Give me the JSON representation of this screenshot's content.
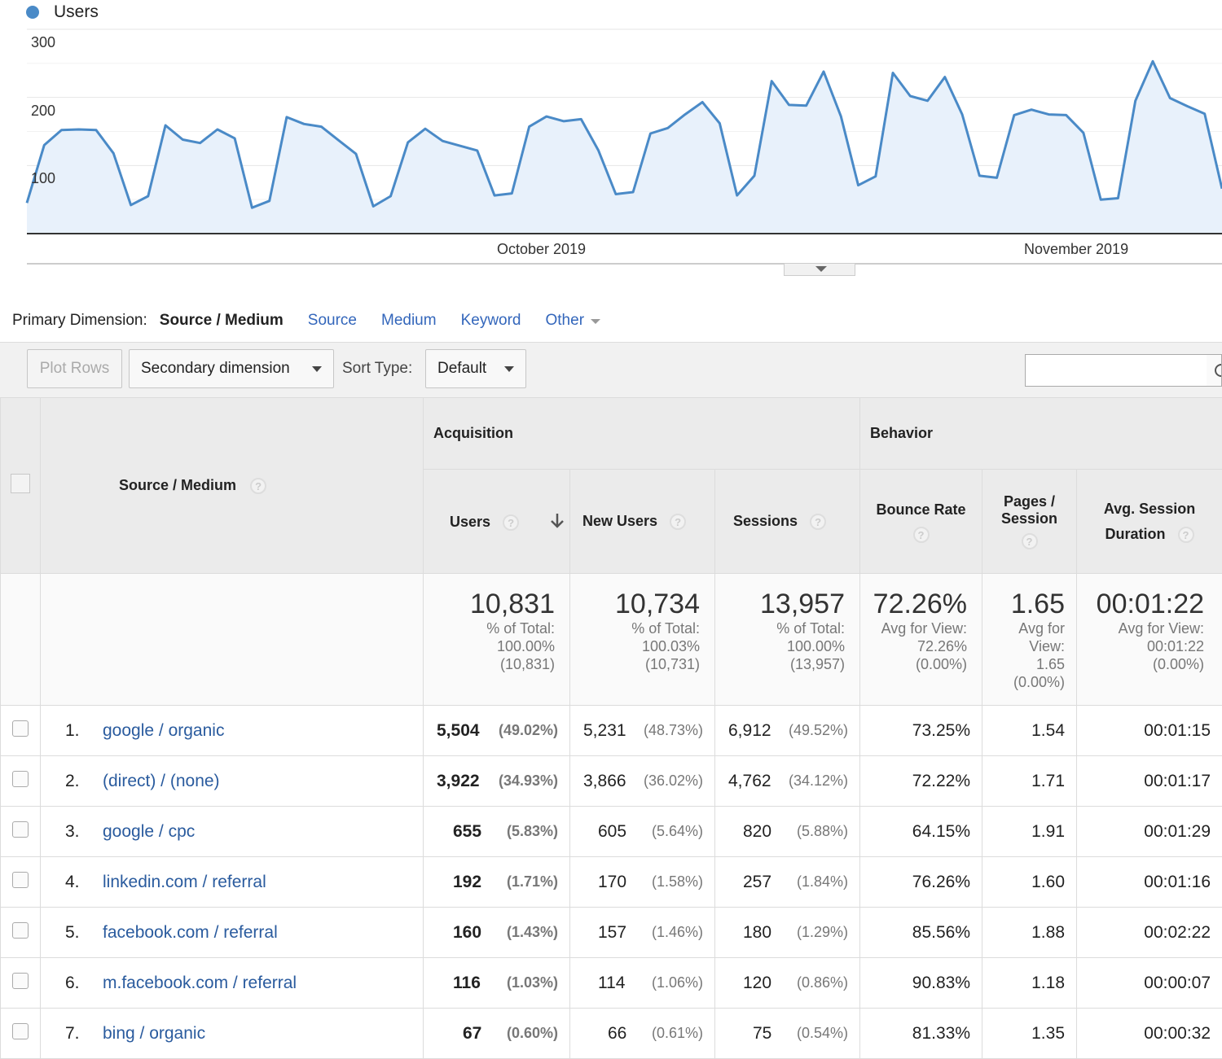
{
  "chart": {
    "legend_label": "Users",
    "color": "#4a8ac7",
    "fill_color": "#e8f1fb",
    "y_ticks": [
      "300",
      "200",
      "100"
    ],
    "x_ticks": [
      "October 2019",
      "November 2019"
    ]
  },
  "chart_data": {
    "type": "area",
    "series": [
      {
        "name": "Users",
        "values": [
          45,
          130,
          152,
          153,
          152,
          118,
          42,
          55,
          159,
          138,
          133,
          153,
          140,
          38,
          48,
          171,
          161,
          157,
          137,
          117,
          40,
          55,
          134,
          154,
          136,
          129,
          122,
          56,
          59,
          157,
          172,
          165,
          168,
          122,
          58,
          61,
          147,
          155,
          175,
          193,
          162,
          56,
          85,
          224,
          189,
          188,
          238,
          172,
          71,
          84,
          236,
          202,
          195,
          230,
          175,
          85,
          82,
          174,
          182,
          175,
          174,
          148,
          50,
          52,
          195,
          253,
          199,
          187,
          176,
          66
        ]
      }
    ],
    "ylim": [
      0,
      300
    ],
    "xlabel": "",
    "ylabel": ""
  },
  "primary_dimension": {
    "label": "Primary Dimension:",
    "active": "Source / Medium",
    "links": [
      "Source",
      "Medium",
      "Keyword"
    ],
    "other": "Other"
  },
  "toolbar": {
    "plot_rows": "Plot Rows",
    "secondary_dimension": "Secondary dimension",
    "sort_type_label": "Sort Type:",
    "sort_type_value": "Default",
    "search_value": ""
  },
  "table": {
    "dimension_header": "Source / Medium",
    "group_acquisition": "Acquisition",
    "group_behavior": "Behavior",
    "headers": {
      "users": "Users",
      "new_users": "New Users",
      "sessions": "Sessions",
      "bounce_rate": "Bounce Rate",
      "pages_session_1": "Pages /",
      "pages_session_2": "Session",
      "avg_session_1": "Avg. Session",
      "avg_session_2": "Duration"
    },
    "help_mark": "?",
    "totals": {
      "users": {
        "value": "10,831",
        "l1": "% of Total:",
        "l2": "100.00%",
        "l3": "(10,831)"
      },
      "new_users": {
        "value": "10,734",
        "l1": "% of Total:",
        "l2": "100.03%",
        "l3": "(10,731)"
      },
      "sessions": {
        "value": "13,957",
        "l1": "% of Total:",
        "l2": "100.00%",
        "l3": "(13,957)"
      },
      "bounce_rate": {
        "value": "72.26%",
        "l1": "Avg for View:",
        "l2": "72.26%",
        "l3": "(0.00%)"
      },
      "pages_session": {
        "value": "1.65",
        "l1": "Avg for",
        "l2": "View:",
        "l3": "1.65",
        "l4": "(0.00%)"
      },
      "avg_session": {
        "value": "00:01:22",
        "l1": "Avg for View:",
        "l2": "00:01:22",
        "l3": "(0.00%)"
      }
    },
    "rows": [
      {
        "idx": "1.",
        "source": "google / organic",
        "users": "5,504",
        "users_pct": "(49.02%)",
        "new_users": "5,231",
        "new_users_pct": "(48.73%)",
        "sessions": "6,912",
        "sessions_pct": "(49.52%)",
        "bounce": "73.25%",
        "pages": "1.54",
        "duration": "00:01:15"
      },
      {
        "idx": "2.",
        "source": "(direct) / (none)",
        "users": "3,922",
        "users_pct": "(34.93%)",
        "new_users": "3,866",
        "new_users_pct": "(36.02%)",
        "sessions": "4,762",
        "sessions_pct": "(34.12%)",
        "bounce": "72.22%",
        "pages": "1.71",
        "duration": "00:01:17"
      },
      {
        "idx": "3.",
        "source": "google / cpc",
        "users": "655",
        "users_pct": "(5.83%)",
        "new_users": "605",
        "new_users_pct": "(5.64%)",
        "sessions": "820",
        "sessions_pct": "(5.88%)",
        "bounce": "64.15%",
        "pages": "1.91",
        "duration": "00:01:29"
      },
      {
        "idx": "4.",
        "source": "linkedin.com / referral",
        "users": "192",
        "users_pct": "(1.71%)",
        "new_users": "170",
        "new_users_pct": "(1.58%)",
        "sessions": "257",
        "sessions_pct": "(1.84%)",
        "bounce": "76.26%",
        "pages": "1.60",
        "duration": "00:01:16"
      },
      {
        "idx": "5.",
        "source": "facebook.com / referral",
        "users": "160",
        "users_pct": "(1.43%)",
        "new_users": "157",
        "new_users_pct": "(1.46%)",
        "sessions": "180",
        "sessions_pct": "(1.29%)",
        "bounce": "85.56%",
        "pages": "1.88",
        "duration": "00:02:22"
      },
      {
        "idx": "6.",
        "source": "m.facebook.com / referral",
        "users": "116",
        "users_pct": "(1.03%)",
        "new_users": "114",
        "new_users_pct": "(1.06%)",
        "sessions": "120",
        "sessions_pct": "(0.86%)",
        "bounce": "90.83%",
        "pages": "1.18",
        "duration": "00:00:07"
      },
      {
        "idx": "7.",
        "source": "bing / organic",
        "users": "67",
        "users_pct": "(0.60%)",
        "new_users": "66",
        "new_users_pct": "(0.61%)",
        "sessions": "75",
        "sessions_pct": "(0.54%)",
        "bounce": "81.33%",
        "pages": "1.35",
        "duration": "00:00:32"
      }
    ]
  }
}
